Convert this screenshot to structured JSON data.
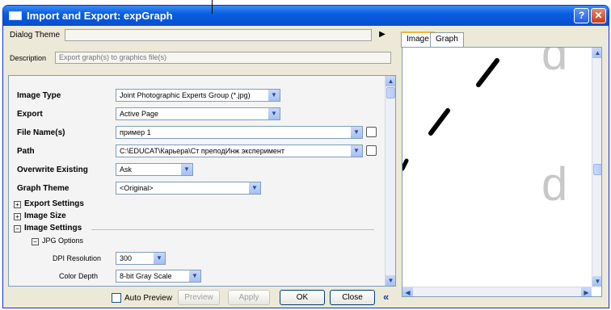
{
  "window": {
    "title": "Import and Export: expGraph"
  },
  "titlebar": {
    "help": "?",
    "close": "✕"
  },
  "dialog_theme": {
    "label": "Dialog Theme",
    "value": "",
    "arrow": "▶"
  },
  "description": {
    "label": "Description",
    "value": "Export graph(s) to graphics file(s)"
  },
  "settings": {
    "image_type": {
      "label": "Image Type",
      "value": "Joint Photographic Experts Group (*.jpg)"
    },
    "export": {
      "label": "Export",
      "value": "Active Page"
    },
    "file_name": {
      "label": "File Name(s)",
      "value": "пример 1"
    },
    "path": {
      "label": "Path",
      "value": "C:\\EDUCAT\\Карьера\\Ст преподИнж эксперимент"
    },
    "overwrite": {
      "label": "Overwrite Existing",
      "value": "Ask"
    },
    "graph_theme": {
      "label": "Graph Theme",
      "value": "<Original>"
    },
    "export_settings": {
      "label": "Export Settings",
      "state": "+"
    },
    "image_size": {
      "label": "Image Size",
      "state": "+"
    },
    "image_settings": {
      "label": "Image Settings",
      "state": "−"
    },
    "jpg_options": {
      "label": "JPG Options",
      "state": "−"
    },
    "dpi": {
      "label": "DPI Resolution",
      "value": "300"
    },
    "color_depth": {
      "label": "Color Depth",
      "value": "8-bit Gray Scale"
    }
  },
  "buttons": {
    "auto_preview": "Auto Preview",
    "preview": "Preview",
    "apply": "Apply",
    "ok": "OK",
    "close": "Close",
    "collapse": "«"
  },
  "preview_tabs": [
    "Image",
    "Graph"
  ],
  "preview_glyph": "d",
  "colors": {
    "titlebar": "#0553d8",
    "dialog_bg": "#ece9d8",
    "combo_button": "#a6c0f2"
  }
}
